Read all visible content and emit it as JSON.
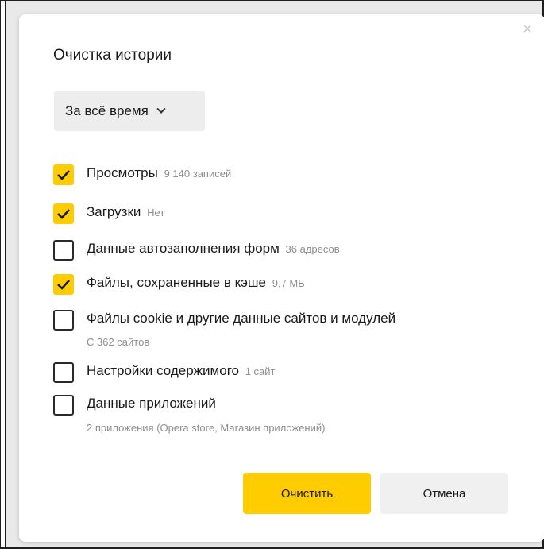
{
  "dialog": {
    "title": "Очистка истории",
    "close_glyph": "×",
    "period": {
      "selected": "За всё время"
    },
    "options": [
      {
        "label": "Просмотры",
        "meta": "9 140 записей",
        "checked": true
      },
      {
        "label": "Загрузки",
        "meta": "Нет",
        "checked": true
      },
      {
        "label": "Данные автозаполнения форм",
        "meta": "36 адресов",
        "checked": false
      },
      {
        "label": "Файлы, сохраненные в кэше",
        "meta": "9,7 МБ",
        "checked": true
      },
      {
        "label": "Файлы cookie и другие данные сайтов и модулей",
        "sub": "С 362 сайтов",
        "checked": false
      },
      {
        "label": "Настройки содержимого",
        "meta": "1 сайт",
        "checked": false
      },
      {
        "label": "Данные приложений",
        "sub": "2 приложения (Opera store, Магазин приложений)",
        "checked": false
      }
    ],
    "buttons": {
      "clear": "Очистить",
      "cancel": "Отмена"
    }
  },
  "colors": {
    "accent": "#ffcc00",
    "secondary_button": "#f0f0f0",
    "meta_text": "#8f8f8f",
    "backdrop": "#e9e9e9"
  },
  "icons": {
    "checkbox_checked": "check-icon",
    "period_dropdown": "chevron-down-icon",
    "close": "close-icon"
  }
}
